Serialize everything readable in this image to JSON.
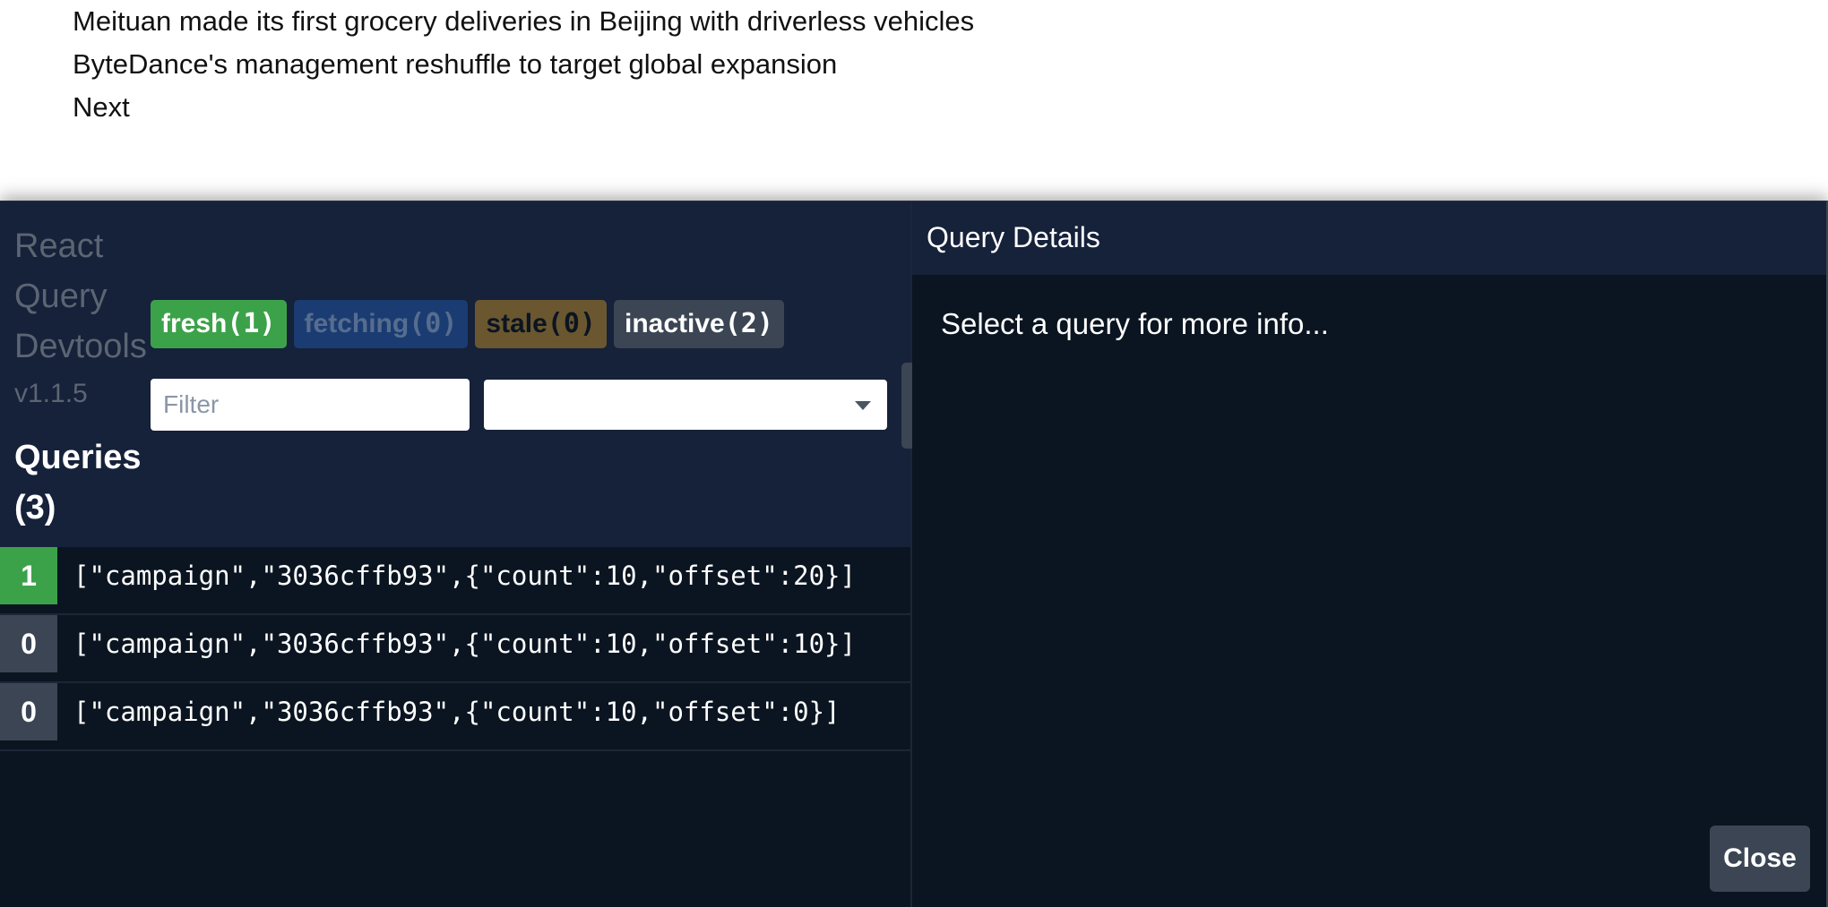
{
  "page": {
    "items": [
      "Meituan made its first grocery deliveries in Beijing with driverless vehicles",
      "ByteDance's management reshuffle to target global expansion",
      "Next"
    ]
  },
  "devtools": {
    "brand": [
      "React",
      "Query",
      "Devtools"
    ],
    "version": "v1.1.5",
    "queries_title": "Queries",
    "queries_count": "(3)",
    "badges": {
      "fresh": {
        "label": "fresh",
        "count": "(1)"
      },
      "fetching": {
        "label": "fetching",
        "count": "(0)"
      },
      "stale": {
        "label": "stale",
        "count": "(0)"
      },
      "inactive": {
        "label": "inactive",
        "count": "(2)"
      }
    },
    "filter": {
      "placeholder": "Filter",
      "value": ""
    },
    "sort": {
      "selected": ""
    },
    "queries": [
      {
        "observers": "1",
        "key": "[\"campaign\",\"3036cffb93\",{\"count\":10,\"offset\":20}]"
      },
      {
        "observers": "0",
        "key": "[\"campaign\",\"3036cffb93\",{\"count\":10,\"offset\":10}]"
      },
      {
        "observers": "0",
        "key": "[\"campaign\",\"3036cffb93\",{\"count\":10,\"offset\":0}]"
      }
    ],
    "details": {
      "title": "Query Details",
      "empty_text": "Select a query for more info..."
    },
    "close_label": "Close"
  },
  "colors": {
    "panel_bg": "#0b1521",
    "header_bg": "#16213a",
    "fresh": "#3ca24a",
    "fetching": "#1b3c72",
    "stale": "#6a5730",
    "inactive": "#3b4553"
  }
}
